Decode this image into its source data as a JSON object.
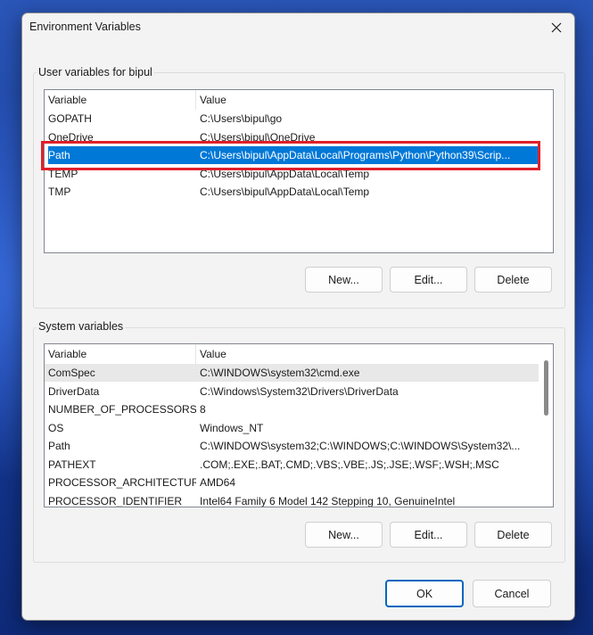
{
  "dialog": {
    "title": "Environment Variables",
    "close_icon": "close-icon",
    "ok_label": "OK",
    "cancel_label": "Cancel"
  },
  "user_vars": {
    "group_label": "User variables for bipul",
    "columns": [
      "Variable",
      "Value"
    ],
    "rows": [
      {
        "name": "GOPATH",
        "value": "C:\\Users\\bipul\\go"
      },
      {
        "name": "OneDrive",
        "value": "C:\\Users\\bipul\\OneDrive"
      },
      {
        "name": "Path",
        "value": "C:\\Users\\bipul\\AppData\\Local\\Programs\\Python\\Python39\\Scrip..."
      },
      {
        "name": "TEMP",
        "value": "C:\\Users\\bipul\\AppData\\Local\\Temp"
      },
      {
        "name": "TMP",
        "value": "C:\\Users\\bipul\\AppData\\Local\\Temp"
      }
    ],
    "selected_row": "Path",
    "new_label": "New...",
    "edit_label": "Edit...",
    "delete_label": "Delete"
  },
  "system_vars": {
    "group_label": "System variables",
    "columns": [
      "Variable",
      "Value"
    ],
    "rows": [
      {
        "name": "ComSpec",
        "value": "C:\\WINDOWS\\system32\\cmd.exe"
      },
      {
        "name": "DriverData",
        "value": "C:\\Windows\\System32\\Drivers\\DriverData"
      },
      {
        "name": "NUMBER_OF_PROCESSORS",
        "value": "8"
      },
      {
        "name": "OS",
        "value": "Windows_NT"
      },
      {
        "name": "Path",
        "value": "C:\\WINDOWS\\system32;C:\\WINDOWS;C:\\WINDOWS\\System32\\..."
      },
      {
        "name": "PATHEXT",
        "value": ".COM;.EXE;.BAT;.CMD;.VBS;.VBE;.JS;.JSE;.WSF;.WSH;.MSC"
      },
      {
        "name": "PROCESSOR_ARCHITECTURE",
        "value": "AMD64"
      },
      {
        "name": "PROCESSOR_IDENTIFIER",
        "value": "Intel64 Family 6 Model 142 Stepping 10, GenuineIntel"
      }
    ],
    "hover_row": "ComSpec",
    "new_label": "New...",
    "edit_label": "Edit...",
    "delete_label": "Delete"
  },
  "colors": {
    "selection": "#0078d7",
    "highlight_box": "#e0202a",
    "default_button_border": "#0067c0"
  }
}
